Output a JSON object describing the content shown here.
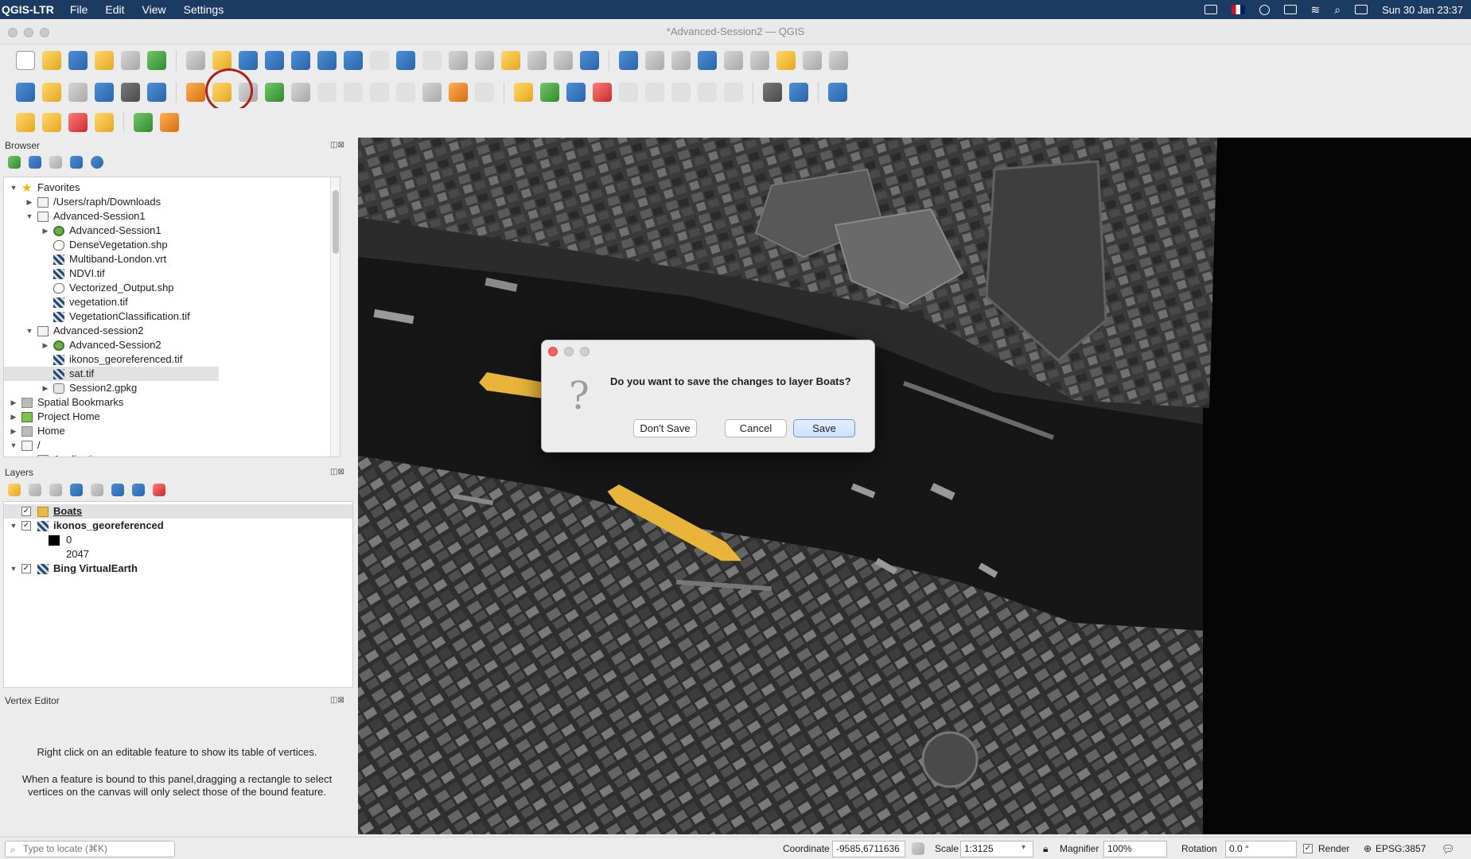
{
  "menubar": {
    "app": "QGIS-LTR",
    "items": [
      "File",
      "Edit",
      "View",
      "Settings"
    ],
    "clock": "Sun 30 Jan  23:37"
  },
  "window": {
    "title": "*Advanced-Session2 — QGIS"
  },
  "browser": {
    "title": "Browser",
    "tree": [
      {
        "label": "Favorites",
        "icon": "star-icon",
        "indent": 0,
        "arrow": "▼"
      },
      {
        "label": "/Users/raph/Downloads",
        "icon": "folder-icon",
        "indent": 1,
        "arrow": "▶"
      },
      {
        "label": "Advanced-Session1",
        "icon": "folder-icon",
        "indent": 1,
        "arrow": "▼"
      },
      {
        "label": "Advanced-Session1",
        "icon": "qgis-project-icon",
        "indent": 2,
        "arrow": "▶"
      },
      {
        "label": "DenseVegetation.shp",
        "icon": "vector-icon",
        "indent": 2,
        "arrow": ""
      },
      {
        "label": "Multiband-London.vrt",
        "icon": "raster-icon",
        "indent": 2,
        "arrow": ""
      },
      {
        "label": "NDVI.tif",
        "icon": "raster-icon",
        "indent": 2,
        "arrow": ""
      },
      {
        "label": "Vectorized_Output.shp",
        "icon": "vector-icon",
        "indent": 2,
        "arrow": ""
      },
      {
        "label": "vegetation.tif",
        "icon": "raster-icon",
        "indent": 2,
        "arrow": ""
      },
      {
        "label": "VegetationClassification.tif",
        "icon": "raster-icon",
        "indent": 2,
        "arrow": ""
      },
      {
        "label": "Advanced-session2",
        "icon": "folder-icon",
        "indent": 1,
        "arrow": "▼"
      },
      {
        "label": "Advanced-Session2",
        "icon": "qgis-project-icon",
        "indent": 2,
        "arrow": "▶"
      },
      {
        "label": "ikonos_georeferenced.tif",
        "icon": "raster-icon",
        "indent": 2,
        "arrow": ""
      },
      {
        "label": "sat.tif",
        "icon": "raster-icon",
        "indent": 2,
        "arrow": "",
        "selected": true
      },
      {
        "label": "Session2.gpkg",
        "icon": "geopackage-icon",
        "indent": 2,
        "arrow": "▶"
      },
      {
        "label": "Spatial Bookmarks",
        "icon": "bookmark-icon",
        "indent": 0,
        "arrow": "▶"
      },
      {
        "label": "Project Home",
        "icon": "project-home-icon",
        "indent": 0,
        "arrow": "▶"
      },
      {
        "label": "Home",
        "icon": "home-icon",
        "indent": 0,
        "arrow": "▶"
      },
      {
        "label": "/",
        "icon": "folder-icon",
        "indent": 0,
        "arrow": "▼"
      },
      {
        "label": "Applications",
        "icon": "folder-icon",
        "indent": 1,
        "arrow": "▶"
      }
    ]
  },
  "layers": {
    "title": "Layers",
    "items": [
      {
        "label": "Boats",
        "icon": "polygon-layer-icon",
        "indent": 0,
        "checked": true,
        "arrow": "",
        "bold": true,
        "underline": true,
        "selected": true
      },
      {
        "label": "ikonos_georeferenced",
        "icon": "raster-icon",
        "indent": 0,
        "checked": true,
        "arrow": "▼",
        "bold": true
      },
      {
        "label": "0",
        "icon": "black-swatch",
        "indent": 1,
        "checked": null,
        "arrow": ""
      },
      {
        "label": "2047",
        "icon": "",
        "indent": 1,
        "checked": null,
        "arrow": ""
      },
      {
        "label": "Bing VirtualEarth",
        "icon": "raster-icon",
        "indent": 0,
        "checked": true,
        "arrow": "▼",
        "bold": true
      }
    ]
  },
  "vertex_editor": {
    "title": "Vertex Editor",
    "msg1": "Right click on an editable feature to show its table of vertices.",
    "msg2": "When a feature is bound to this panel,dragging a rectangle to select vertices on the canvas will only select those of the bound feature."
  },
  "dialog": {
    "message": "Do you want to save the changes to layer Boats?",
    "dont_save": "Don't Save",
    "cancel": "Cancel",
    "save": "Save"
  },
  "statusbar": {
    "locate_placeholder": "Type to locate (⌘K)",
    "coordinate_label": "Coordinate",
    "coordinate_value": "-9585,6711636",
    "scale_label": "Scale",
    "scale_value": "1:3125",
    "magnifier_label": "Magnifier",
    "magnifier_value": "100%",
    "rotation_label": "Rotation",
    "rotation_value": "0.0 °",
    "render_label": "Render",
    "crs": "EPSG:3857"
  },
  "colors": {
    "menubar": "#1b3b63",
    "boat_feature": "#e8b53a",
    "highlight_circle": "#b01e1e"
  }
}
